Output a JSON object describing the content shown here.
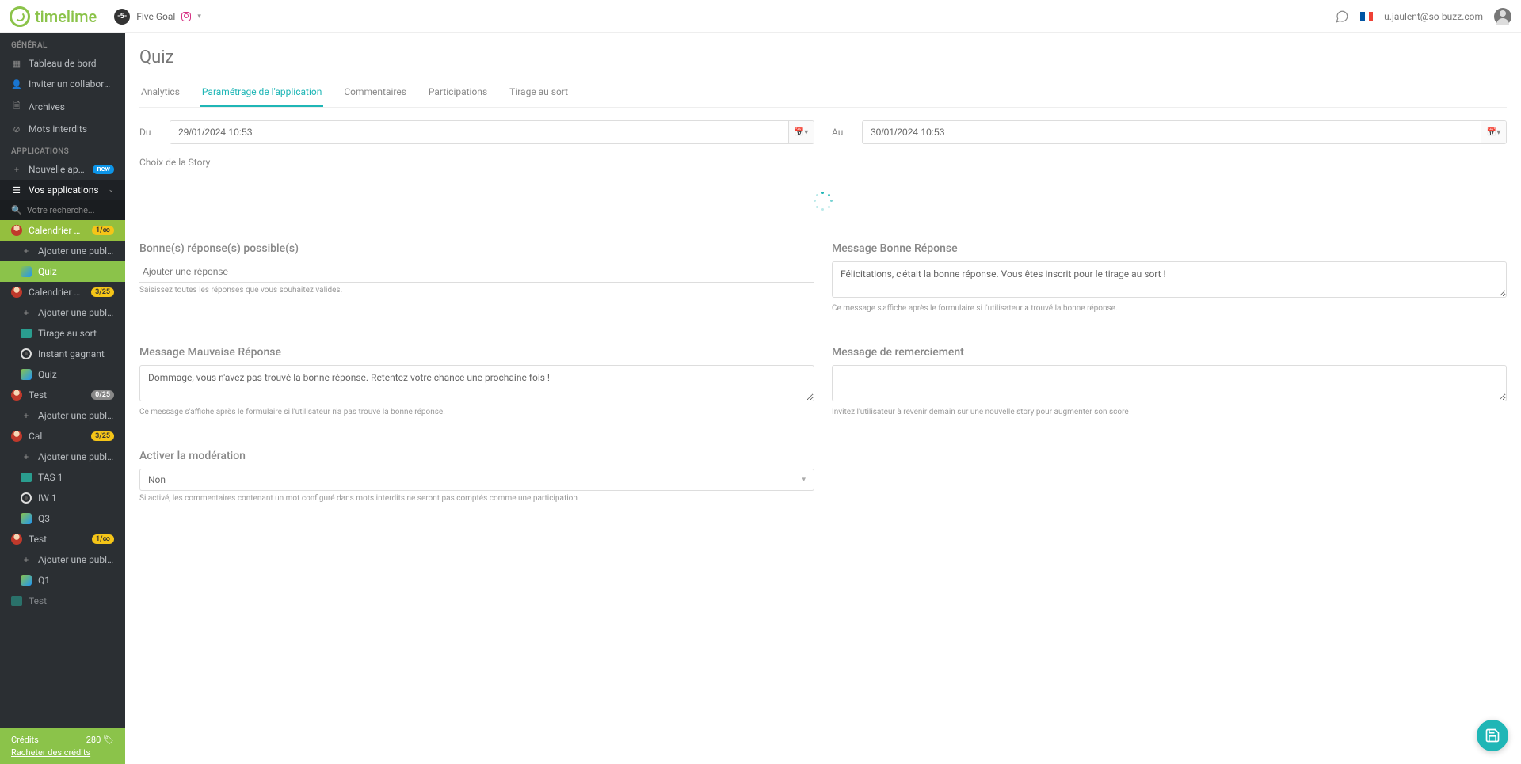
{
  "brand": "timelime",
  "account": {
    "badge": "-5-",
    "name": "Five Goal"
  },
  "user_email": "u.jaulent@so-buzz.com",
  "sidebar": {
    "sections": {
      "general": "GÉNÉRAL",
      "applications": "APPLICATIONS"
    },
    "general_items": [
      {
        "label": "Tableau de bord"
      },
      {
        "label": "Inviter un collaborateur"
      },
      {
        "label": "Archives"
      },
      {
        "label": "Mots interdits"
      }
    ],
    "new_app": {
      "label": "Nouvelle application",
      "badge": "new"
    },
    "your_apps": "Vos applications",
    "search_placeholder": "Votre recherche...",
    "apps": [
      {
        "name": "Calendrier de l'A...",
        "badge": "1/∞",
        "badge_type": "yellow",
        "children": [
          {
            "label": "Ajouter une publication",
            "icon": "+"
          },
          {
            "label": "Quiz",
            "icon": "qz",
            "active": true
          }
        ]
      },
      {
        "name": "Calendrier de l'A...",
        "badge": "3/25",
        "badge_type": "yellow",
        "children": [
          {
            "label": "Ajouter une publication",
            "icon": "+"
          },
          {
            "label": "Tirage au sort",
            "icon": "cam"
          },
          {
            "label": "Instant gagnant",
            "icon": "wheel"
          },
          {
            "label": "Quiz",
            "icon": "qz"
          }
        ]
      },
      {
        "name": "Test",
        "badge": "0/25",
        "badge_type": "gray",
        "children": [
          {
            "label": "Ajouter une publication",
            "icon": "+"
          }
        ]
      },
      {
        "name": "Cal",
        "badge": "3/25",
        "badge_type": "yellow",
        "children": [
          {
            "label": "Ajouter une publication",
            "icon": "+"
          },
          {
            "label": "TAS 1",
            "icon": "cam"
          },
          {
            "label": "IW 1",
            "icon": "wheel"
          },
          {
            "label": "Q3",
            "icon": "qz"
          }
        ]
      },
      {
        "name": "Test",
        "badge": "1/∞",
        "badge_type": "yellow",
        "children": [
          {
            "label": "Ajouter une publication",
            "icon": "+"
          },
          {
            "label": "Q1",
            "icon": "qz"
          }
        ]
      },
      {
        "name": "Test",
        "badge": "",
        "badge_type": "",
        "children": []
      }
    ],
    "footer": {
      "credits_label": "Crédits",
      "credits_value": "280",
      "buy_link": "Racheter des crédits"
    }
  },
  "page": {
    "title": "Quiz",
    "tabs": [
      "Analytics",
      "Paramétrage de l'application",
      "Commentaires",
      "Participations",
      "Tirage au sort"
    ],
    "active_tab": 1,
    "date_from": {
      "label": "Du",
      "value": "29/01/2024 10:53"
    },
    "date_to": {
      "label": "Au",
      "value": "30/01/2024 10:53"
    },
    "story_label": "Choix de la Story",
    "good_answers": {
      "title": "Bonne(s) réponse(s) possible(s)",
      "placeholder": "Ajouter une réponse",
      "help": "Saisissez toutes les réponses que vous souhaitez valides."
    },
    "good_msg": {
      "title": "Message Bonne Réponse",
      "value": "Félicitations, c'était la bonne réponse. Vous êtes inscrit pour le tirage au sort !",
      "help": "Ce message s'affiche après le formulaire si l'utilisateur a trouvé la bonne réponse."
    },
    "bad_msg": {
      "title": "Message Mauvaise Réponse",
      "value": "Dommage, vous n'avez pas trouvé la bonne réponse. Retentez votre chance une prochaine fois !",
      "help": "Ce message s'affiche après le formulaire si l'utilisateur n'a pas trouvé la bonne réponse."
    },
    "thank_msg": {
      "title": "Message de remerciement",
      "value": "",
      "help": "Invitez l'utilisateur à revenir demain sur une nouvelle story pour augmenter son score"
    },
    "moderation": {
      "title": "Activer la modération",
      "value": "Non",
      "help": "Si activé, les commentaires contenant un mot configuré dans mots interdits ne seront pas comptés comme une participation"
    }
  }
}
